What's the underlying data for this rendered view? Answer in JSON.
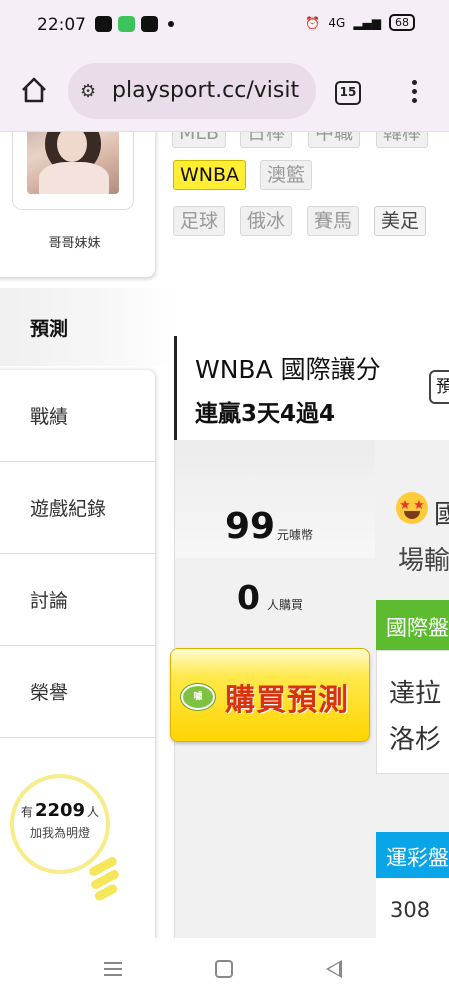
{
  "status_bar": {
    "time": "22:07",
    "network": "4G",
    "battery": "68"
  },
  "browser": {
    "url": "playsport.cc/visit",
    "tab_count": "15"
  },
  "leagues": {
    "row1_partial": [
      "MLB",
      "日棒",
      "中職",
      "韓棒"
    ],
    "row2": [
      "WNBA",
      "澳籃"
    ],
    "row3": [
      "足球",
      "俄冰",
      "賽馬",
      "美足"
    ],
    "active": "WNBA"
  },
  "profile": {
    "name": "哥哥妹妹"
  },
  "sidebar": {
    "active_tab": "預測",
    "items": [
      {
        "label": "戰績"
      },
      {
        "label": "遊戲紀錄"
      },
      {
        "label": "討論"
      },
      {
        "label": "榮譽"
      }
    ],
    "bulb": {
      "prefix": "有",
      "count": "2209",
      "suffix": "人",
      "caption": "加我為明燈"
    }
  },
  "prediction": {
    "title": "WNBA 國際讓分",
    "streak": "連贏3天4過4",
    "button_partial": "預",
    "price": "99",
    "price_unit": "元噱幣",
    "buyers": "0",
    "buyers_unit": "人購買",
    "buy_label": "購買預測",
    "badge_text": "噱",
    "frag_text1": "國",
    "frag_text2": "場輸",
    "green_header": "國際盤",
    "match_line1": "達拉",
    "match_line2": "洛杉",
    "blue_header": "運彩盤",
    "row_number": "308"
  },
  "colors": {
    "accent_yellow": "#ffee33",
    "green_header": "#5dbb2f",
    "blue_header": "#0aa5e8",
    "buy_text": "#d8320e"
  }
}
